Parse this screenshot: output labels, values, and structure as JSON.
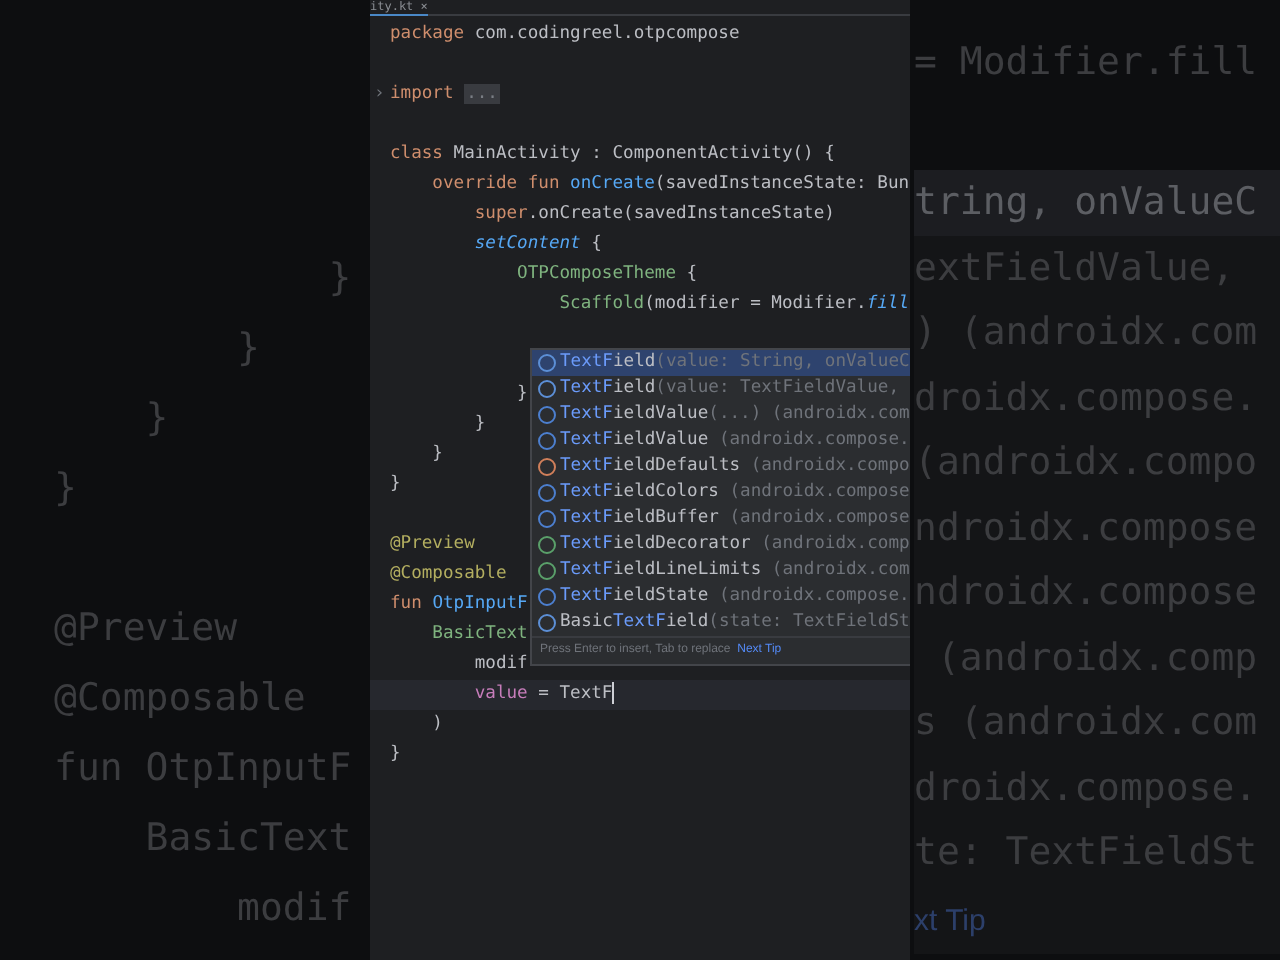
{
  "backdrop_left": {
    "lines": [
      {
        "kind": "code",
        "text": "            }"
      },
      {
        "kind": "code",
        "text": "        }"
      },
      {
        "kind": "code",
        "text": "    }"
      },
      {
        "kind": "code",
        "text": "}"
      },
      {
        "kind": "blank"
      },
      {
        "kind": "code",
        "text": "@Preview"
      },
      {
        "kind": "code",
        "text": "@Composable"
      },
      {
        "kind": "code",
        "text": "fun OtpInputF"
      },
      {
        "kind": "code",
        "text": "    BasicText"
      },
      {
        "kind": "code",
        "text": "        modif"
      }
    ]
  },
  "editor": {
    "tab": {
      "label": "ity.kt",
      "close": "×"
    },
    "lines": [
      {
        "kind": "code",
        "tokens": [
          {
            "kind": "kw",
            "text": "package "
          },
          {
            "kind": "plain",
            "text": "com.codingreel.otpcompose"
          }
        ]
      },
      {
        "kind": "blank"
      },
      {
        "kind": "code",
        "gutter": "›",
        "tokens": [
          {
            "kind": "kw",
            "text": "import "
          },
          {
            "kind": "fold",
            "text": "..."
          }
        ]
      },
      {
        "kind": "blank"
      },
      {
        "kind": "code",
        "tokens": [
          {
            "kind": "kw",
            "text": "class "
          },
          {
            "kind": "plain",
            "text": "MainActivity : ComponentActivity() {"
          }
        ]
      },
      {
        "kind": "code",
        "tokens": [
          {
            "kind": "kw",
            "text": "    override fun "
          },
          {
            "kind": "fn",
            "text": "onCreate"
          },
          {
            "kind": "plain",
            "text": "(savedInstanceState: Bun"
          }
        ]
      },
      {
        "kind": "code",
        "tokens": [
          {
            "kind": "kw",
            "text": "        super"
          },
          {
            "kind": "plain",
            "text": ".onCreate(savedInstanceState)"
          }
        ]
      },
      {
        "kind": "code",
        "tokens": [
          {
            "kind": "ext",
            "text": "        setContent"
          },
          {
            "kind": "plain",
            "text": " {"
          }
        ]
      },
      {
        "kind": "code",
        "tokens": [
          {
            "kind": "call",
            "text": "            OTPComposeTheme"
          },
          {
            "kind": "plain",
            "text": " {"
          }
        ]
      },
      {
        "kind": "code",
        "tokens": [
          {
            "kind": "call",
            "text": "                Scaffold"
          },
          {
            "kind": "plain",
            "text": "(modifier = Modifier."
          },
          {
            "kind": "ext",
            "text": "fill"
          }
        ]
      },
      {
        "kind": "blank"
      },
      {
        "kind": "blank"
      },
      {
        "kind": "code",
        "tokens": [
          {
            "kind": "plain",
            "text": "            }"
          }
        ]
      },
      {
        "kind": "code",
        "tokens": [
          {
            "kind": "plain",
            "text": "        }"
          }
        ]
      },
      {
        "kind": "code",
        "tokens": [
          {
            "kind": "plain",
            "text": "    }"
          }
        ]
      },
      {
        "kind": "code",
        "tokens": [
          {
            "kind": "plain",
            "text": "}"
          }
        ]
      },
      {
        "kind": "blank"
      },
      {
        "kind": "code",
        "tokens": [
          {
            "kind": "ann",
            "text": "@Preview"
          }
        ]
      },
      {
        "kind": "code",
        "tokens": [
          {
            "kind": "ann",
            "text": "@Composable"
          }
        ]
      },
      {
        "kind": "code",
        "tokens": [
          {
            "kind": "kw",
            "text": "fun "
          },
          {
            "kind": "fn",
            "text": "OtpInputF"
          }
        ]
      },
      {
        "kind": "code",
        "tokens": [
          {
            "kind": "call",
            "text": "    BasicText"
          }
        ]
      },
      {
        "kind": "code",
        "tokens": [
          {
            "kind": "plain",
            "text": "        modif"
          }
        ]
      },
      {
        "kind": "code",
        "current": true,
        "tokens": [
          {
            "kind": "param",
            "text": "        value"
          },
          {
            "kind": "plain",
            "text": " = TextF"
          }
        ]
      },
      {
        "kind": "code",
        "tokens": [
          {
            "kind": "plain",
            "text": "    )"
          }
        ]
      },
      {
        "kind": "code",
        "tokens": [
          {
            "kind": "plain",
            "text": "}"
          }
        ]
      }
    ],
    "completion": {
      "items": [
        {
          "kind": "function",
          "selected": true,
          "match": "TextF",
          "rest": "ield",
          "detail": "(value: String, onValueC"
        },
        {
          "kind": "function",
          "selected": false,
          "match": "TextF",
          "rest": "ield",
          "detail": "(value: TextFieldValue,"
        },
        {
          "kind": "class",
          "selected": false,
          "match": "TextF",
          "rest": "ieldValue",
          "detail": "(...) (androidx.com"
        },
        {
          "kind": "class",
          "selected": false,
          "match": "TextF",
          "rest": "ieldValue",
          "detail": " (androidx.compose."
        },
        {
          "kind": "object",
          "selected": false,
          "match": "TextF",
          "rest": "ieldDefaults",
          "detail": " (androidx.compo"
        },
        {
          "kind": "class",
          "selected": false,
          "match": "TextF",
          "rest": "ieldColors",
          "detail": " (androidx.compose"
        },
        {
          "kind": "class",
          "selected": false,
          "match": "TextF",
          "rest": "ieldBuffer",
          "detail": " (androidx.compose"
        },
        {
          "kind": "interface",
          "selected": false,
          "match": "TextF",
          "rest": "ieldDecorator",
          "detail": " (androidx.comp"
        },
        {
          "kind": "interface",
          "selected": false,
          "match": "TextF",
          "rest": "ieldLineLimits",
          "detail": " (androidx.com"
        },
        {
          "kind": "class",
          "selected": false,
          "match": "TextF",
          "rest": "ieldState",
          "detail": " (androidx.compose."
        },
        {
          "kind": "function",
          "selected": false,
          "prefix": "Basic",
          "match": "TextF",
          "rest": "ield",
          "detail": "(state: TextFieldSt"
        }
      ],
      "hint": "Press Enter to insert, Tab to replace",
      "tip": "Next Tip"
    }
  },
  "backdrop_right": {
    "top": "= Modifier.fill",
    "lines": [
      "tring, onValueC",
      "extFieldValue,",
      ") (androidx.com",
      "droidx.compose.",
      "(androidx.compo",
      "ndroidx.compose",
      "ndroidx.compose",
      " (androidx.comp",
      "s (androidx.com",
      "droidx.compose.",
      "te: TextFieldSt"
    ],
    "tip": "xt Tip"
  }
}
